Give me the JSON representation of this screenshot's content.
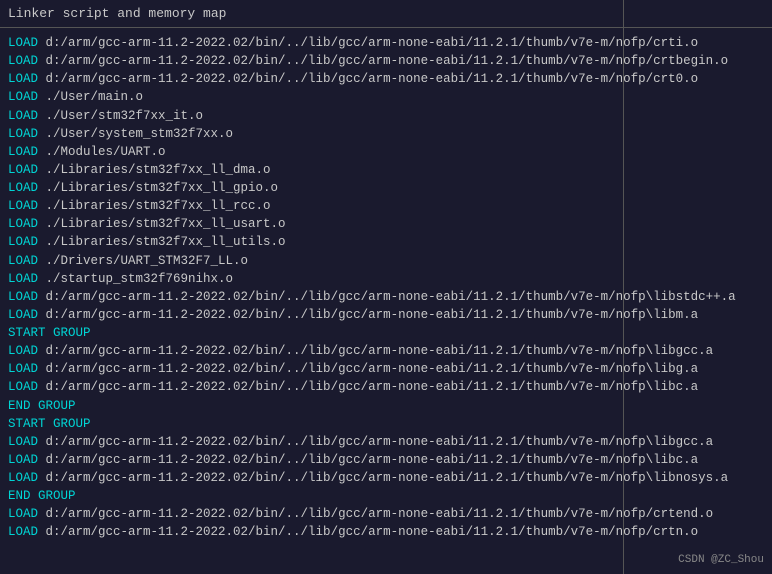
{
  "title": "Linker script and memory map",
  "lines": [
    {
      "type": "load",
      "text": "LOAD d:/arm/gcc-arm-11.2-2022.02/bin/../lib/gcc/arm-none-eabi/11.2.1/thumb/v7e-m/nofp/crti.o"
    },
    {
      "type": "load",
      "text": "LOAD d:/arm/gcc-arm-11.2-2022.02/bin/../lib/gcc/arm-none-eabi/11.2.1/thumb/v7e-m/nofp/crtbegin.o"
    },
    {
      "type": "load",
      "text": "LOAD d:/arm/gcc-arm-11.2-2022.02/bin/../lib/gcc/arm-none-eabi/11.2.1/thumb/v7e-m/nofp/crt0.o"
    },
    {
      "type": "load",
      "text": "LOAD ./User/main.o"
    },
    {
      "type": "load",
      "text": "LOAD ./User/stm32f7xx_it.o"
    },
    {
      "type": "load",
      "text": "LOAD ./User/system_stm32f7xx.o"
    },
    {
      "type": "load",
      "text": "LOAD ./Modules/UART.o"
    },
    {
      "type": "load",
      "text": "LOAD ./Libraries/stm32f7xx_ll_dma.o"
    },
    {
      "type": "load",
      "text": "LOAD ./Libraries/stm32f7xx_ll_gpio.o"
    },
    {
      "type": "load",
      "text": "LOAD ./Libraries/stm32f7xx_ll_rcc.o"
    },
    {
      "type": "load",
      "text": "LOAD ./Libraries/stm32f7xx_ll_usart.o"
    },
    {
      "type": "load",
      "text": "LOAD ./Libraries/stm32f7xx_ll_utils.o"
    },
    {
      "type": "load",
      "text": "LOAD ./Drivers/UART_STM32F7_LL.o"
    },
    {
      "type": "load",
      "text": "LOAD ./startup_stm32f769nihx.o"
    },
    {
      "type": "load",
      "text": "LOAD d:/arm/gcc-arm-11.2-2022.02/bin/../lib/gcc/arm-none-eabi/11.2.1/thumb/v7e-m/nofp\\libstdc++.a"
    },
    {
      "type": "load",
      "text": "LOAD d:/arm/gcc-arm-11.2-2022.02/bin/../lib/gcc/arm-none-eabi/11.2.1/thumb/v7e-m/nofp\\libm.a"
    },
    {
      "type": "keyword",
      "text": "START GROUP"
    },
    {
      "type": "load",
      "text": "LOAD d:/arm/gcc-arm-11.2-2022.02/bin/../lib/gcc/arm-none-eabi/11.2.1/thumb/v7e-m/nofp\\libgcc.a"
    },
    {
      "type": "load",
      "text": "LOAD d:/arm/gcc-arm-11.2-2022.02/bin/../lib/gcc/arm-none-eabi/11.2.1/thumb/v7e-m/nofp\\libg.a"
    },
    {
      "type": "load",
      "text": "LOAD d:/arm/gcc-arm-11.2-2022.02/bin/../lib/gcc/arm-none-eabi/11.2.1/thumb/v7e-m/nofp\\libc.a"
    },
    {
      "type": "keyword",
      "text": "END GROUP"
    },
    {
      "type": "keyword",
      "text": "START GROUP"
    },
    {
      "type": "load",
      "text": "LOAD d:/arm/gcc-arm-11.2-2022.02/bin/../lib/gcc/arm-none-eabi/11.2.1/thumb/v7e-m/nofp\\libgcc.a"
    },
    {
      "type": "load",
      "text": "LOAD d:/arm/gcc-arm-11.2-2022.02/bin/../lib/gcc/arm-none-eabi/11.2.1/thumb/v7e-m/nofp\\libc.a"
    },
    {
      "type": "load",
      "text": "LOAD d:/arm/gcc-arm-11.2-2022.02/bin/../lib/gcc/arm-none-eabi/11.2.1/thumb/v7e-m/nofp\\libnosys.a"
    },
    {
      "type": "keyword",
      "text": "END GROUP"
    },
    {
      "type": "load",
      "text": "LOAD d:/arm/gcc-arm-11.2-2022.02/bin/../lib/gcc/arm-none-eabi/11.2.1/thumb/v7e-m/nofp/crtend.o"
    },
    {
      "type": "load",
      "text": "LOAD d:/arm/gcc-arm-11.2-2022.02/bin/../lib/gcc/arm-none-eabi/11.2.1/thumb/v7e-m/nofp/crtn.o"
    }
  ],
  "watermark": "CSDN @ZC_Shou"
}
